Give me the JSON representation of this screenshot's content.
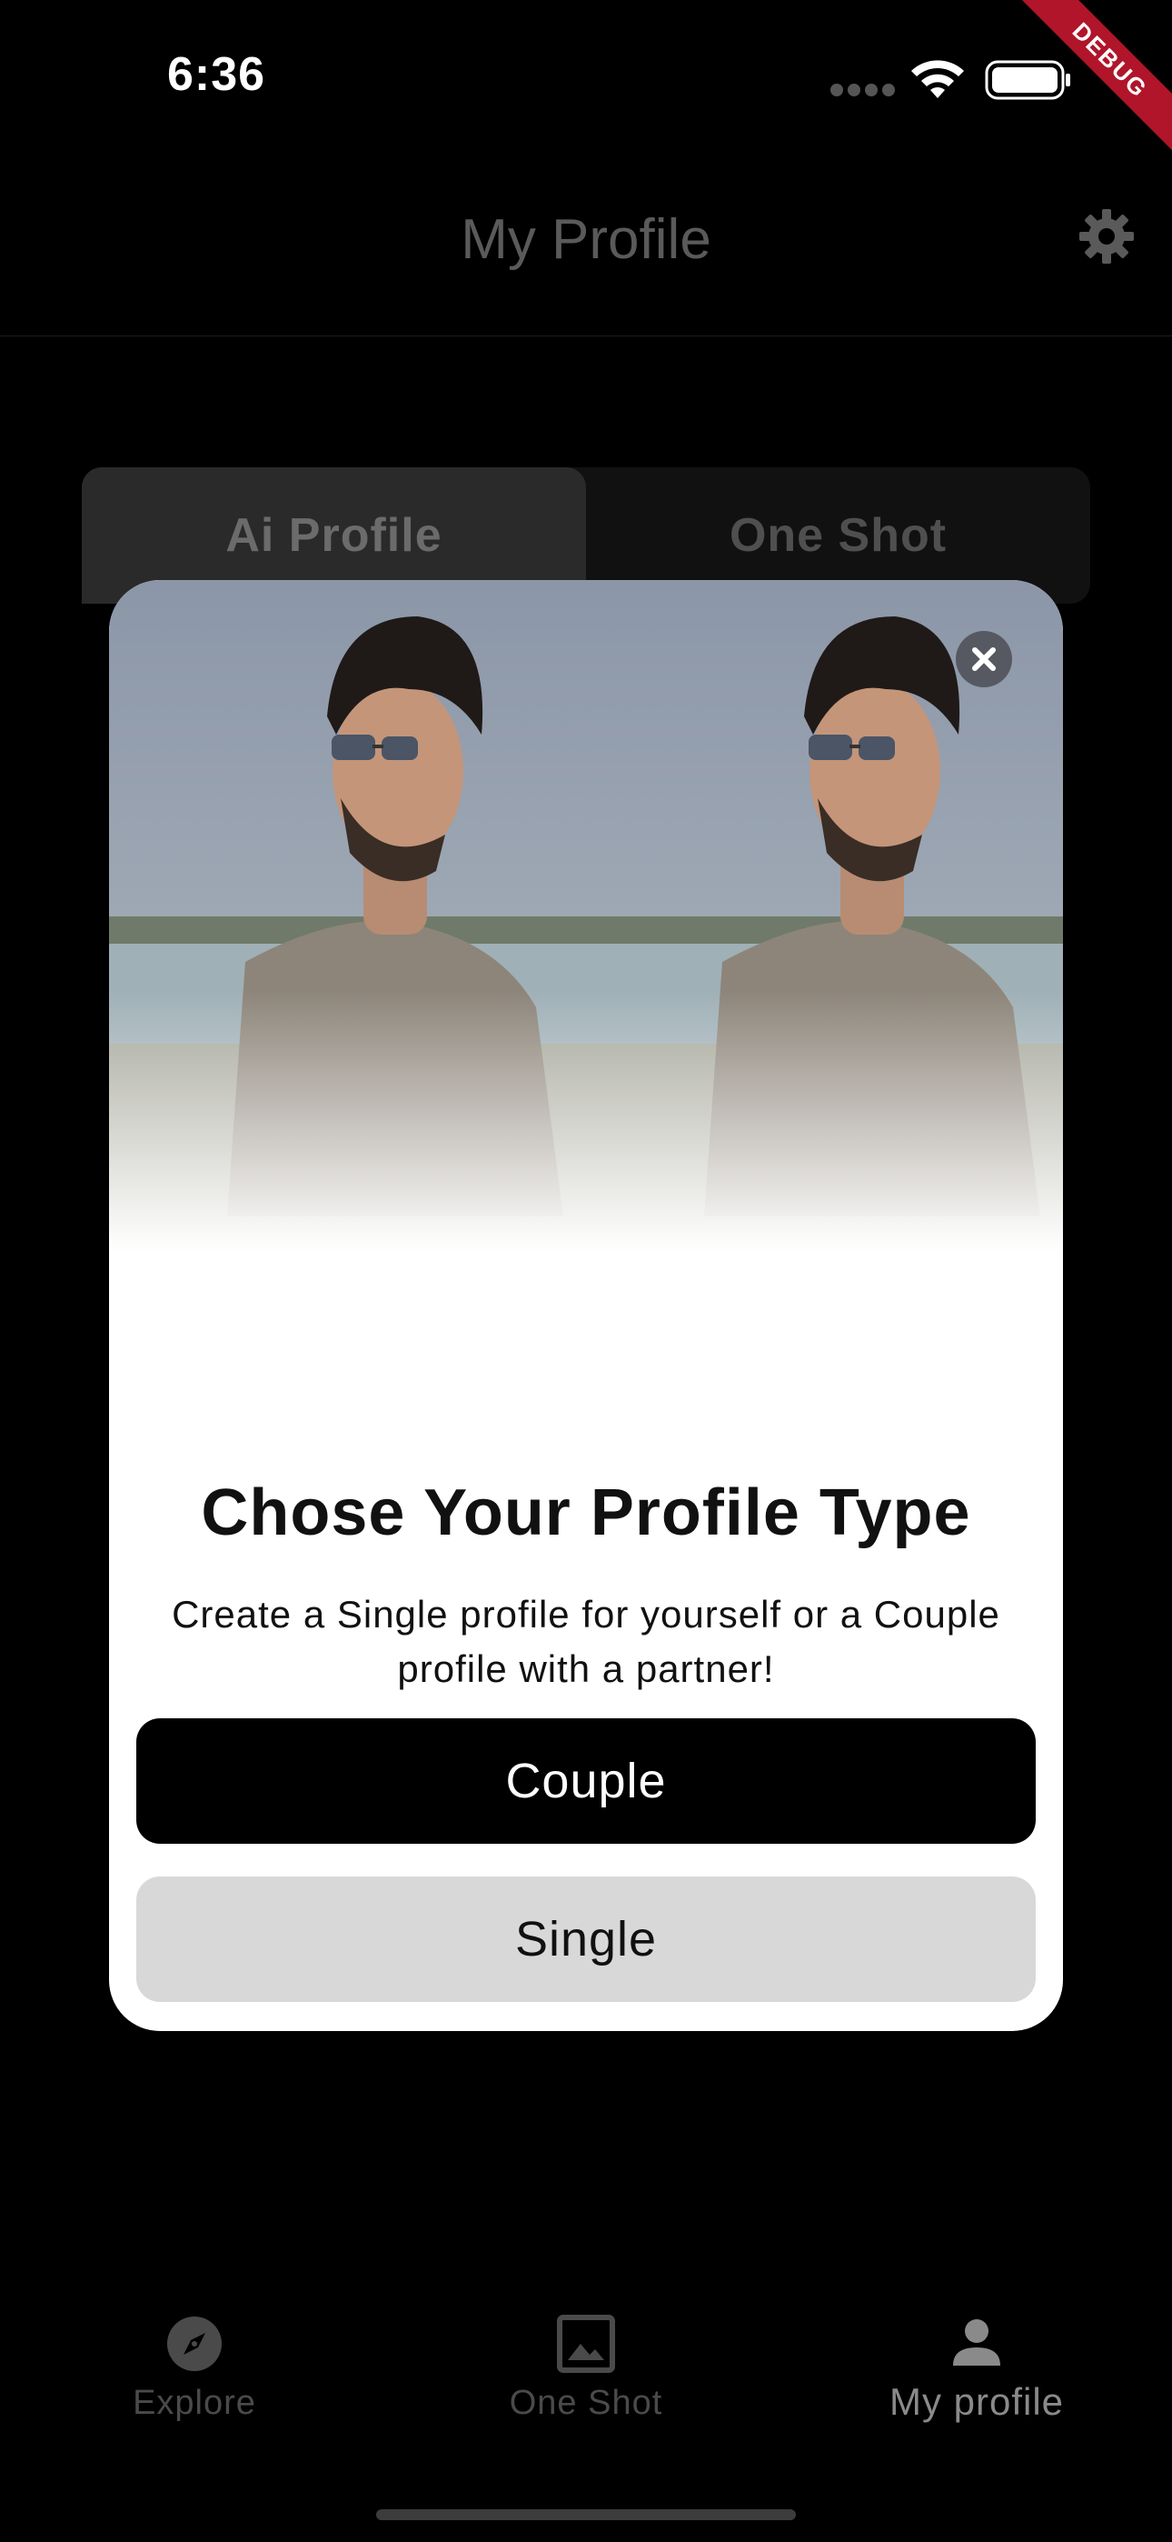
{
  "status_bar": {
    "time": "6:36"
  },
  "debug_ribbon": {
    "label": "DEBUG"
  },
  "header": {
    "title": "My Profile"
  },
  "tabs": [
    {
      "label": "Ai Profile",
      "selected": true
    },
    {
      "label": "One Shot",
      "selected": false
    }
  ],
  "modal": {
    "title": "Chose Your Profile Type",
    "subtitle": "Create a Single profile for yourself or a Couple profile with a partner!",
    "couple_button": "Couple",
    "single_button": "Single"
  },
  "bottom_nav": {
    "items": [
      {
        "label": "Explore",
        "icon": "compass-icon"
      },
      {
        "label": "One Shot",
        "icon": "image-icon"
      },
      {
        "label": "My profile",
        "icon": "person-icon",
        "active": true
      }
    ]
  },
  "colors": {
    "background": "#000000",
    "modal_bg": "#ffffff",
    "primary_button": "#000000",
    "secondary_button": "#d8d8d8",
    "debug_ribbon": "#b0152a"
  }
}
